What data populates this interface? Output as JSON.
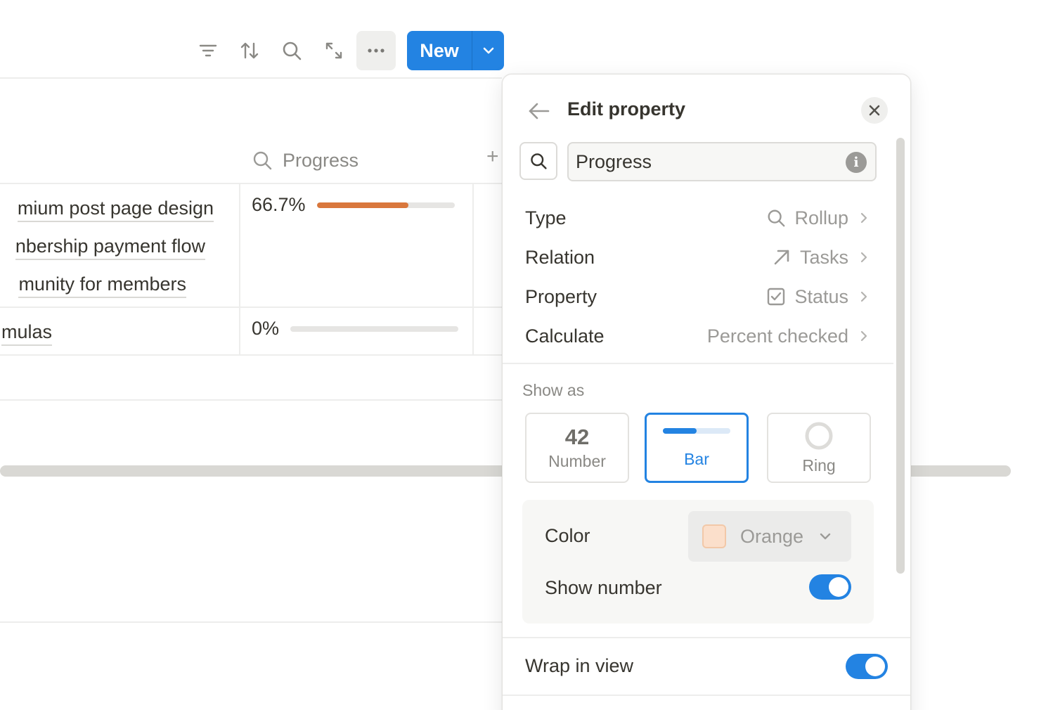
{
  "toolbar": {
    "icons": [
      "filter-icon",
      "sort-icon",
      "search-icon",
      "expand-icon",
      "more-icon"
    ],
    "new_label": "New"
  },
  "table": {
    "column_header": "Progress",
    "rows": [
      {
        "tasks": [
          "mium post page design",
          "nbership payment flow",
          "munity for members"
        ],
        "progress_text": "66.7%",
        "progress": 0.667
      },
      {
        "tasks": [
          "mulas"
        ],
        "progress_text": "0%",
        "progress": 0
      }
    ]
  },
  "panel": {
    "title": "Edit property",
    "name_value": "Progress",
    "info_glyph": "i",
    "rows": [
      {
        "label": "Type",
        "value": "Rollup",
        "icon": "search-icon"
      },
      {
        "label": "Relation",
        "value": "Tasks",
        "icon": "arrow-up-right-icon"
      },
      {
        "label": "Property",
        "value": "Status",
        "icon": "checkbox-icon"
      },
      {
        "label": "Calculate",
        "value": "Percent checked",
        "icon": ""
      }
    ],
    "show_as_label": "Show as",
    "show_as_options": [
      {
        "label": "Number",
        "preview": "42"
      },
      {
        "label": "Bar",
        "selected": true
      },
      {
        "label": "Ring"
      }
    ],
    "color_label": "Color",
    "color_value": "Orange",
    "show_number_label": "Show number",
    "show_number_on": true,
    "wrap_label": "Wrap in view",
    "wrap_on": true
  },
  "colors": {
    "accent": "#2383e2",
    "progress_orange": "#d9773c",
    "swatch_orange": "#fbdfcb"
  }
}
